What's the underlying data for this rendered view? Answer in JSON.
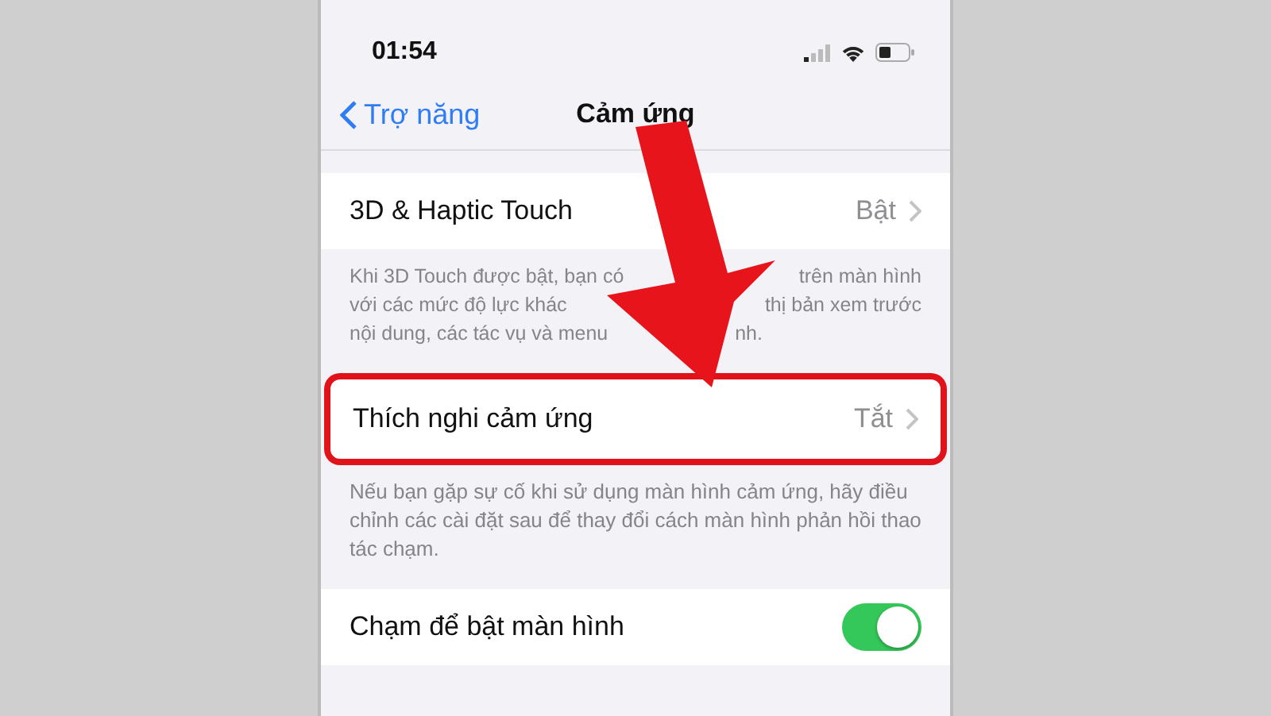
{
  "status_bar": {
    "time": "01:54"
  },
  "nav": {
    "back": "Trợ năng",
    "title": "Cảm ứng"
  },
  "sections": [
    {
      "rows": [
        {
          "kind": "link",
          "label": "3D & Haptic Touch",
          "value": "Bật",
          "highlighted": false
        }
      ],
      "footer_lines": [
        [
          "Khi 3D Touch được bật, bạn có",
          "trên màn hình"
        ],
        [
          "với các mức độ lực khác",
          "thị bản xem trước"
        ],
        [
          "nội dung, các tác vụ và menu",
          "nh."
        ]
      ]
    },
    {
      "rows": [
        {
          "kind": "link",
          "label": "Thích nghi cảm ứng",
          "value": "Tắt",
          "highlighted": true
        }
      ],
      "footer": "Nếu bạn gặp sự cố khi sử dụng màn hình cảm ứng, hãy điều chỉnh các cài đặt sau để thay đổi cách màn hình phản hồi thao tác chạm."
    },
    {
      "rows": [
        {
          "kind": "toggle",
          "label": "Chạm để bật màn hình",
          "on": true,
          "highlighted": false
        }
      ]
    }
  ]
}
